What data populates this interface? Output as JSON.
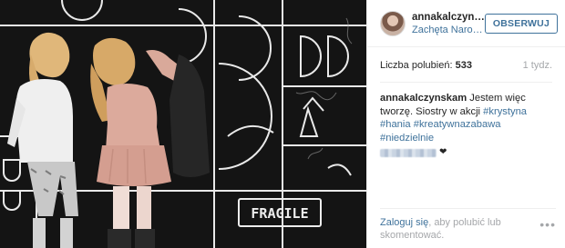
{
  "post": {
    "username": "annakalczynskam",
    "location": "Zachęta Narodowa Galeria Sztuki",
    "follow_label": "OBSERWUJ",
    "likes_label": "Liczba polubień:",
    "likes_count": "533",
    "time_ago": "1 tydz.",
    "caption": {
      "author": "annakalczynskam",
      "text": "Jestem więc tworzę. Siostry w akcji",
      "tags": [
        "#krystyna",
        "#hania",
        "#kreatywnazabawa",
        "#niedzielnie"
      ]
    },
    "login_link": "Zaloguj się",
    "login_rest": ", aby polubić lub skomentować.",
    "more_icon": "•••",
    "heart_icon": "❤"
  },
  "photo": {
    "board_text": "FRAGILE"
  },
  "colors": {
    "link": "#3f729b",
    "muted": "#a5a7aa",
    "text": "#262626",
    "border": "#efefef"
  }
}
